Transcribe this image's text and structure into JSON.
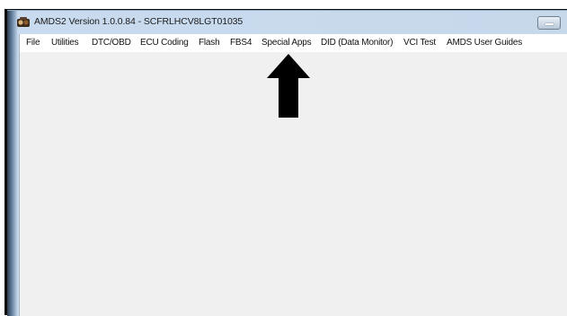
{
  "window": {
    "title": "AMDS2 Version 1.0.0.84 - SCFRLHCV8LGT01035",
    "app_icon": "amds-app-icon",
    "minimize_icon": "minimize-icon"
  },
  "menu": {
    "items": [
      {
        "label": "File"
      },
      {
        "label": "Utilities"
      },
      {
        "label": "DTC/OBD"
      },
      {
        "label": "ECU Coding"
      },
      {
        "label": "Flash"
      },
      {
        "label": "FBS4"
      },
      {
        "label": "Special Apps"
      },
      {
        "label": "DID (Data Monitor)"
      },
      {
        "label": "VCI Test"
      },
      {
        "label": "AMDS User Guides"
      }
    ]
  },
  "annotation": {
    "arrow_icon": "up-arrow-icon",
    "arrow_color": "#000000"
  },
  "colors": {
    "titlebar": "#c7d8eb",
    "client_background": "#f0f0f0",
    "menubar_background": "#ffffff"
  }
}
